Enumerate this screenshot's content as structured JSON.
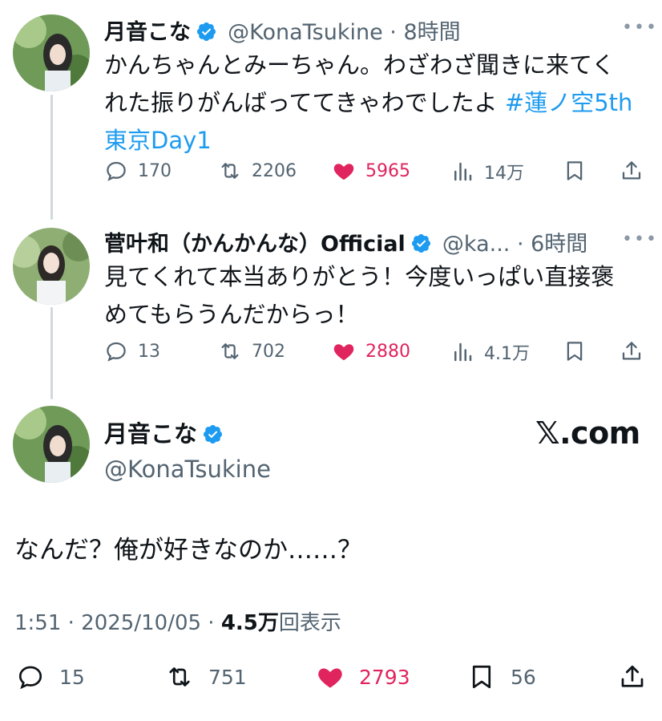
{
  "tweet1": {
    "name": "月音こな",
    "handle": "@KonaTsukine",
    "time": "8時間",
    "text": "かんちゃんとみーちゃん。わざわざ聞きに来てく",
    "text2": "れた振りがんばっててきゃわでしたよ ",
    "hashtag": "#蓮ノ空5th",
    "hashtag2": "東京Day1",
    "replies": "170",
    "reposts": "2206",
    "likes": "5965",
    "views": "14万"
  },
  "tweet2": {
    "name": "菅叶和（かんかんな）Official",
    "handle": "@ka...",
    "time": "6時間",
    "text": "見てくれて本当ありがとう！今度いっぱい直接褒",
    "text2": "めてもらうんだからっ！",
    "replies": "13",
    "reposts": "702",
    "likes": "2880",
    "views": "4.1万"
  },
  "tweet3": {
    "name": "月音こな",
    "handle": "@KonaTsukine",
    "source": "𝕏.com",
    "text": "なんだ？俺が好きなのか……？",
    "time": "1:51 · 2025/10/05 · ",
    "views_count": "4.5万",
    "views_label": "回表示",
    "replies": "15",
    "reposts": "751",
    "likes": "2793",
    "bookmarks": "56"
  },
  "icons": {
    "reply": "reply-icon",
    "repost": "repost-icon",
    "like": "heart-icon",
    "views": "views-icon",
    "bookmark": "bookmark-icon",
    "share": "share-icon",
    "verified": "verified-badge-icon",
    "more": "more-icon"
  },
  "colors": {
    "like": "#e0245e",
    "verified": "#1d9bf0",
    "hashtag": "#1d9bf0",
    "secondary": "#536471"
  }
}
